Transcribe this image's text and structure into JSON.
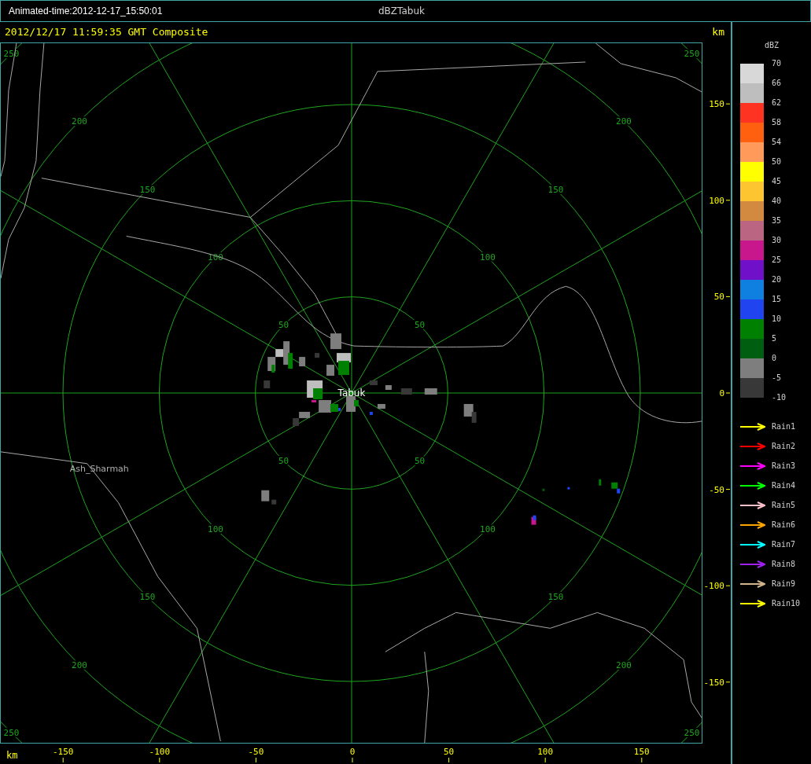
{
  "window": {
    "timestamp_label": "Animated-time:2012-12-17_15:50:01",
    "title": "dBZTabuk"
  },
  "plot": {
    "header": "2012/12/17 11:59:35 GMT Composite",
    "unit_label": "km",
    "range_rings": [
      {
        "labels": [
          "50",
          "50",
          "50",
          "50"
        ]
      },
      {
        "labels": [
          "100",
          "100",
          "100",
          "100"
        ]
      },
      {
        "labels": [
          "150",
          "150",
          "150",
          "150"
        ]
      },
      {
        "labels": [
          "200",
          "200",
          "200",
          "200"
        ]
      },
      {
        "labels": [
          "250",
          "250",
          "250",
          "250"
        ]
      }
    ],
    "radar_site": "Tabuk",
    "towns": [
      "Ash_Sharmah"
    ],
    "y_axis": {
      "ticks": [
        "150",
        "100",
        "50",
        "0",
        "-50",
        "-100",
        "-150"
      ]
    },
    "x_axis": {
      "unit_label": "km",
      "ticks": [
        "-150",
        "-100",
        "-50",
        "0",
        "50",
        "100",
        "150"
      ]
    }
  },
  "legend": {
    "title": "dBZ",
    "scale": [
      {
        "label": "70",
        "color": "#d8d8d8"
      },
      {
        "label": "66",
        "color": "#bebebe"
      },
      {
        "label": "62",
        "color": "#ff3322"
      },
      {
        "label": "58",
        "color": "#ff6010"
      },
      {
        "label": "54",
        "color": "#ff9a5a"
      },
      {
        "label": "50",
        "color": "#ffff00"
      },
      {
        "label": "45",
        "color": "#fdc630"
      },
      {
        "label": "40",
        "color": "#d28a40"
      },
      {
        "label": "35",
        "color": "#ba6682"
      },
      {
        "label": "30",
        "color": "#c8168c"
      },
      {
        "label": "25",
        "color": "#7010c8"
      },
      {
        "label": "20",
        "color": "#1080e0"
      },
      {
        "label": "15",
        "color": "#2044f0"
      },
      {
        "label": "10",
        "color": "#008000"
      },
      {
        "label": "5",
        "color": "#005e10"
      },
      {
        "label": "0",
        "color": "#7e7e7e"
      },
      {
        "label": "-5",
        "color": "#383838"
      }
    ],
    "bottom_label": "-10",
    "arrows": [
      {
        "label": "Rain1",
        "color": "#ffff00"
      },
      {
        "label": "Rain2",
        "color": "#ff0000"
      },
      {
        "label": "Rain3",
        "color": "#ff00ff"
      },
      {
        "label": "Rain4",
        "color": "#00ff00"
      },
      {
        "label": "Rain5",
        "color": "#ffc0cb"
      },
      {
        "label": "Rain6",
        "color": "#ffa500"
      },
      {
        "label": "Rain7",
        "color": "#00ffff"
      },
      {
        "label": "Rain8",
        "color": "#a020f0"
      },
      {
        "label": "Rain9",
        "color": "#d2b48c"
      },
      {
        "label": "Rain10",
        "color": "#ffff00"
      }
    ]
  }
}
